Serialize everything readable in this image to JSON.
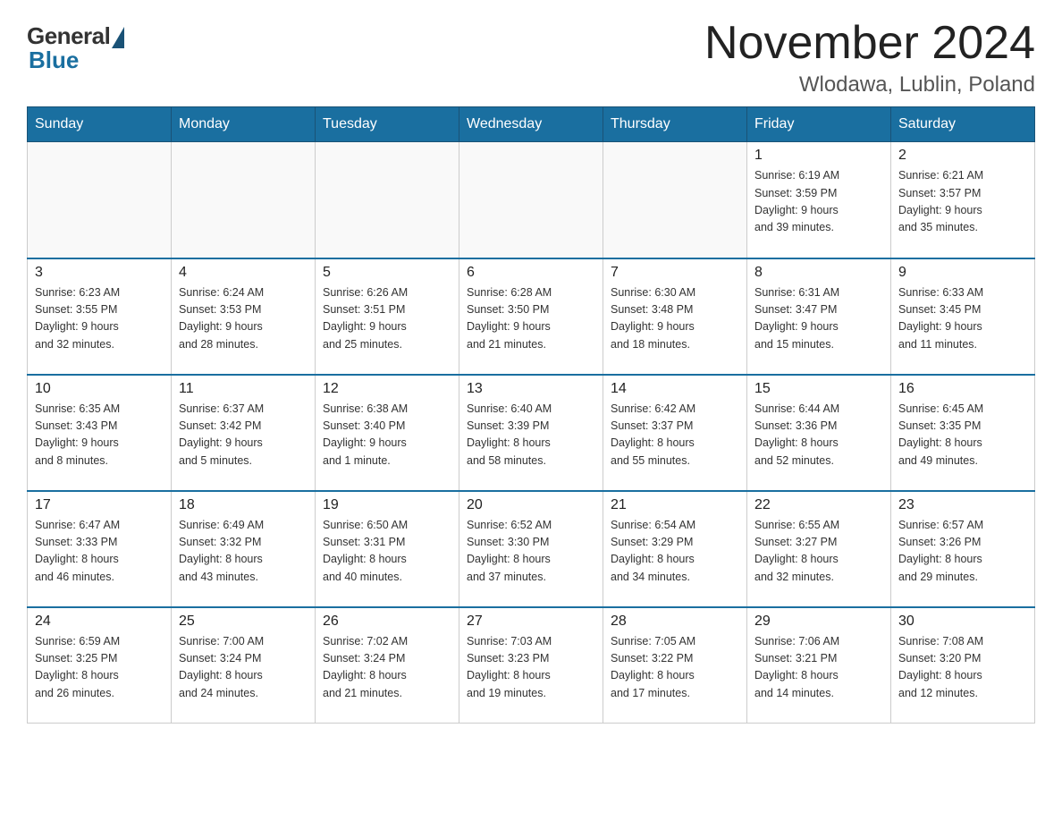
{
  "header": {
    "logo_general": "General",
    "logo_blue": "Blue",
    "month_title": "November 2024",
    "location": "Wlodawa, Lublin, Poland"
  },
  "days_of_week": [
    "Sunday",
    "Monday",
    "Tuesday",
    "Wednesday",
    "Thursday",
    "Friday",
    "Saturday"
  ],
  "weeks": [
    [
      {
        "day": "",
        "info": ""
      },
      {
        "day": "",
        "info": ""
      },
      {
        "day": "",
        "info": ""
      },
      {
        "day": "",
        "info": ""
      },
      {
        "day": "",
        "info": ""
      },
      {
        "day": "1",
        "info": "Sunrise: 6:19 AM\nSunset: 3:59 PM\nDaylight: 9 hours\nand 39 minutes."
      },
      {
        "day": "2",
        "info": "Sunrise: 6:21 AM\nSunset: 3:57 PM\nDaylight: 9 hours\nand 35 minutes."
      }
    ],
    [
      {
        "day": "3",
        "info": "Sunrise: 6:23 AM\nSunset: 3:55 PM\nDaylight: 9 hours\nand 32 minutes."
      },
      {
        "day": "4",
        "info": "Sunrise: 6:24 AM\nSunset: 3:53 PM\nDaylight: 9 hours\nand 28 minutes."
      },
      {
        "day": "5",
        "info": "Sunrise: 6:26 AM\nSunset: 3:51 PM\nDaylight: 9 hours\nand 25 minutes."
      },
      {
        "day": "6",
        "info": "Sunrise: 6:28 AM\nSunset: 3:50 PM\nDaylight: 9 hours\nand 21 minutes."
      },
      {
        "day": "7",
        "info": "Sunrise: 6:30 AM\nSunset: 3:48 PM\nDaylight: 9 hours\nand 18 minutes."
      },
      {
        "day": "8",
        "info": "Sunrise: 6:31 AM\nSunset: 3:47 PM\nDaylight: 9 hours\nand 15 minutes."
      },
      {
        "day": "9",
        "info": "Sunrise: 6:33 AM\nSunset: 3:45 PM\nDaylight: 9 hours\nand 11 minutes."
      }
    ],
    [
      {
        "day": "10",
        "info": "Sunrise: 6:35 AM\nSunset: 3:43 PM\nDaylight: 9 hours\nand 8 minutes."
      },
      {
        "day": "11",
        "info": "Sunrise: 6:37 AM\nSunset: 3:42 PM\nDaylight: 9 hours\nand 5 minutes."
      },
      {
        "day": "12",
        "info": "Sunrise: 6:38 AM\nSunset: 3:40 PM\nDaylight: 9 hours\nand 1 minute."
      },
      {
        "day": "13",
        "info": "Sunrise: 6:40 AM\nSunset: 3:39 PM\nDaylight: 8 hours\nand 58 minutes."
      },
      {
        "day": "14",
        "info": "Sunrise: 6:42 AM\nSunset: 3:37 PM\nDaylight: 8 hours\nand 55 minutes."
      },
      {
        "day": "15",
        "info": "Sunrise: 6:44 AM\nSunset: 3:36 PM\nDaylight: 8 hours\nand 52 minutes."
      },
      {
        "day": "16",
        "info": "Sunrise: 6:45 AM\nSunset: 3:35 PM\nDaylight: 8 hours\nand 49 minutes."
      }
    ],
    [
      {
        "day": "17",
        "info": "Sunrise: 6:47 AM\nSunset: 3:33 PM\nDaylight: 8 hours\nand 46 minutes."
      },
      {
        "day": "18",
        "info": "Sunrise: 6:49 AM\nSunset: 3:32 PM\nDaylight: 8 hours\nand 43 minutes."
      },
      {
        "day": "19",
        "info": "Sunrise: 6:50 AM\nSunset: 3:31 PM\nDaylight: 8 hours\nand 40 minutes."
      },
      {
        "day": "20",
        "info": "Sunrise: 6:52 AM\nSunset: 3:30 PM\nDaylight: 8 hours\nand 37 minutes."
      },
      {
        "day": "21",
        "info": "Sunrise: 6:54 AM\nSunset: 3:29 PM\nDaylight: 8 hours\nand 34 minutes."
      },
      {
        "day": "22",
        "info": "Sunrise: 6:55 AM\nSunset: 3:27 PM\nDaylight: 8 hours\nand 32 minutes."
      },
      {
        "day": "23",
        "info": "Sunrise: 6:57 AM\nSunset: 3:26 PM\nDaylight: 8 hours\nand 29 minutes."
      }
    ],
    [
      {
        "day": "24",
        "info": "Sunrise: 6:59 AM\nSunset: 3:25 PM\nDaylight: 8 hours\nand 26 minutes."
      },
      {
        "day": "25",
        "info": "Sunrise: 7:00 AM\nSunset: 3:24 PM\nDaylight: 8 hours\nand 24 minutes."
      },
      {
        "day": "26",
        "info": "Sunrise: 7:02 AM\nSunset: 3:24 PM\nDaylight: 8 hours\nand 21 minutes."
      },
      {
        "day": "27",
        "info": "Sunrise: 7:03 AM\nSunset: 3:23 PM\nDaylight: 8 hours\nand 19 minutes."
      },
      {
        "day": "28",
        "info": "Sunrise: 7:05 AM\nSunset: 3:22 PM\nDaylight: 8 hours\nand 17 minutes."
      },
      {
        "day": "29",
        "info": "Sunrise: 7:06 AM\nSunset: 3:21 PM\nDaylight: 8 hours\nand 14 minutes."
      },
      {
        "day": "30",
        "info": "Sunrise: 7:08 AM\nSunset: 3:20 PM\nDaylight: 8 hours\nand 12 minutes."
      }
    ]
  ]
}
